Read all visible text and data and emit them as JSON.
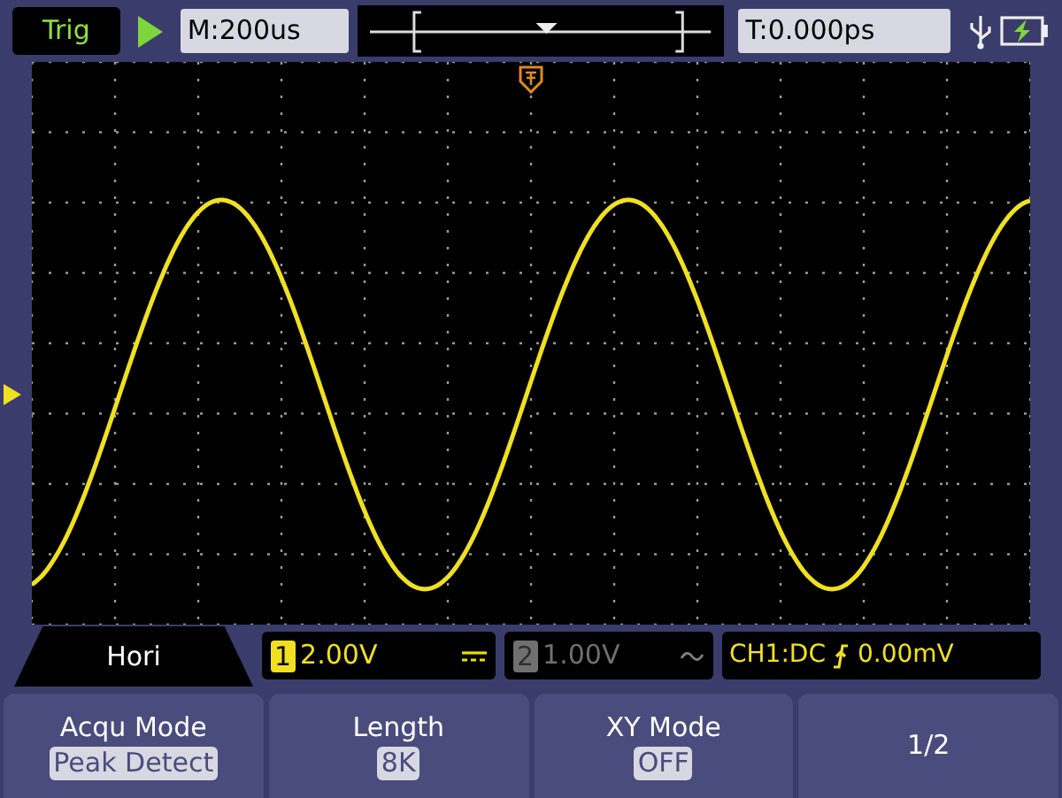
{
  "top_bar": {
    "trigger_status": "Trig",
    "timebase": "M:200us",
    "trigger_time": "T:0.000ps"
  },
  "channels": [
    {
      "number": "1",
      "scale": "2.00V",
      "kind": "dc",
      "enabled": true
    },
    {
      "number": "2",
      "scale": "1.00V",
      "kind": "ac",
      "enabled": false
    }
  ],
  "trigger": {
    "source": "CH1:DC",
    "level": "0.00mV"
  },
  "menu": {
    "title": "Hori",
    "buttons": [
      {
        "label": "Acqu Mode",
        "value": "Peak Detect"
      },
      {
        "label": "Length",
        "value": "8K"
      },
      {
        "label": "XY Mode",
        "value": "OFF"
      },
      {
        "label": "1/2"
      }
    ]
  }
}
